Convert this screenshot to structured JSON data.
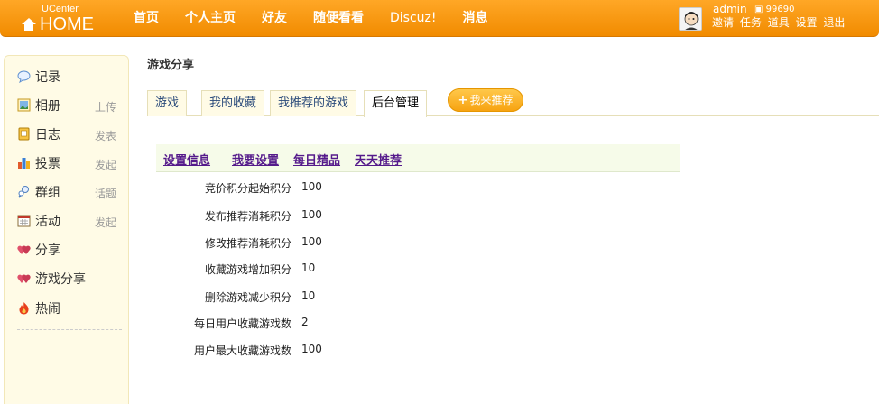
{
  "header": {
    "logo_top": "UCenter",
    "logo_main": "HOME",
    "nav": [
      "首页",
      "个人主页",
      "好友",
      "随便看看",
      "Discuz!",
      "消息"
    ],
    "username": "admin",
    "credit": "99690",
    "user_menu": [
      "邀请",
      "任务",
      "道具",
      "设置",
      "退出"
    ]
  },
  "sidebar": {
    "items": [
      {
        "label": "记录",
        "sub": "",
        "icon": "speech-bubble-icon"
      },
      {
        "label": "相册",
        "sub": "上传",
        "icon": "photo-icon"
      },
      {
        "label": "日志",
        "sub": "发表",
        "icon": "notebook-icon"
      },
      {
        "label": "投票",
        "sub": "发起",
        "icon": "bar-chart-icon"
      },
      {
        "label": "群组",
        "sub": "话题",
        "icon": "group-icon"
      },
      {
        "label": "活动",
        "sub": "发起",
        "icon": "calendar-icon"
      },
      {
        "label": "分享",
        "sub": "",
        "icon": "heart-icon"
      },
      {
        "label": "游戏分享",
        "sub": "",
        "icon": "heart-icon"
      },
      {
        "label": "热闹",
        "sub": "",
        "icon": "fire-icon"
      }
    ]
  },
  "main": {
    "title": "游戏分享",
    "tabs": [
      "游戏",
      "我的收藏",
      "我推荐的游戏",
      "后台管理"
    ],
    "recommend_button": "我来推荐",
    "subnav": [
      "设置信息",
      "我要设置",
      "每日精品",
      "天天推荐"
    ],
    "settings": [
      {
        "key": "竞价积分起始积分",
        "value": "100"
      },
      {
        "key": "发布推荐消耗积分",
        "value": "100"
      },
      {
        "key": "修改推荐消耗积分",
        "value": "100"
      },
      {
        "key": "收藏游戏增加积分",
        "value": "10"
      },
      {
        "key": "删除游戏减少积分",
        "value": "10"
      },
      {
        "key": "每日用户收藏游戏数",
        "value": "2"
      },
      {
        "key": "用户最大收藏游戏数",
        "value": "100"
      }
    ]
  }
}
